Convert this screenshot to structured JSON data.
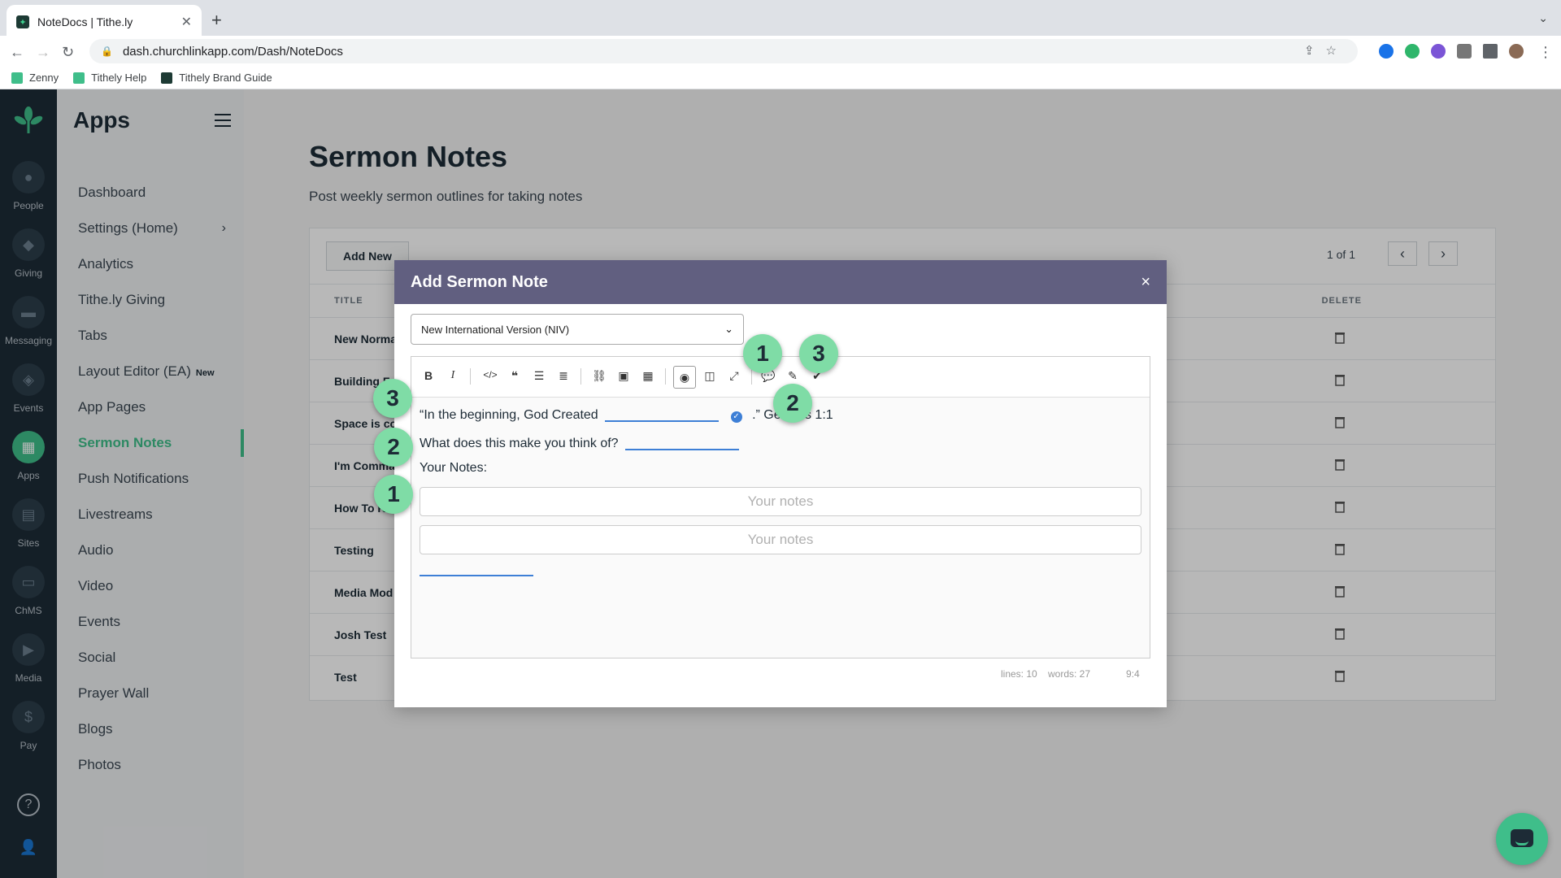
{
  "browser": {
    "tab_title": "NoteDocs | Tithe.ly",
    "url": "dash.churchlinkapp.com/Dash/NoteDocs",
    "bookmarks": [
      "Zenny",
      "Tithely Help",
      "Tithely Brand Guide"
    ]
  },
  "rail": {
    "items": [
      "People",
      "Giving",
      "Messaging",
      "Events",
      "Apps",
      "Sites",
      "ChMS",
      "Media",
      "Pay"
    ],
    "help": "?"
  },
  "appnav": {
    "title": "Apps",
    "items": [
      "Dashboard",
      "Settings (Home)",
      "Analytics",
      "Tithe.ly Giving",
      "Tabs",
      "Layout Editor (EA)",
      "App Pages",
      "Sermon Notes",
      "Push Notifications",
      "Livestreams",
      "Audio",
      "Video",
      "Events",
      "Social",
      "Prayer Wall",
      "Blogs",
      "Photos"
    ],
    "new_badge": "New"
  },
  "main": {
    "title": "Sermon Notes",
    "subtitle": "Post weekly sermon outlines for taking notes",
    "add_new": "Add New",
    "pager": "1 of 1",
    "col_title": "TITLE",
    "col_delete": "DELETE",
    "rows": [
      "New Norma",
      "Building F",
      "Space is co",
      "I'm Comma",
      "How To K",
      "Testing",
      "Media Mod",
      "Josh Test",
      "Test"
    ]
  },
  "modal": {
    "title": "Add Sermon Note",
    "close": "×",
    "version": "New International Version (NIV)",
    "line1_pre": "“In the beginning, God Created",
    "line1_post": ".” Genesis 1:1",
    "line2": "What does this make you think of?",
    "line3": "Your Notes:",
    "notes_placeholder": "Your notes",
    "lines": "lines: 10",
    "words": "words: 27",
    "cursor": "9:4"
  },
  "markers": [
    "1",
    "2",
    "3",
    "1",
    "2",
    "3"
  ],
  "colors": {
    "accent": "#3fbe8a",
    "modal_header": "#615f80",
    "rail": "#1d2b36",
    "marker": "#7fdca6"
  }
}
